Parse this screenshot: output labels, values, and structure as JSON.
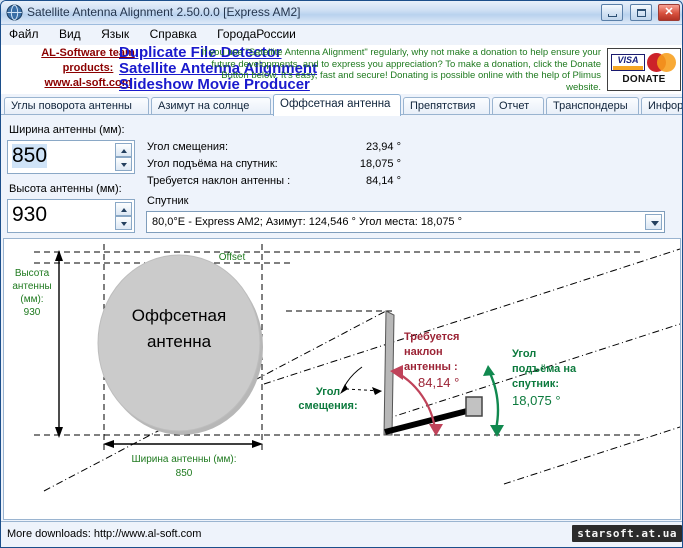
{
  "window": {
    "title": "Satellite Antenna Alignment 2.50.0.0 [Express AM2]",
    "icon": "satellite-dish-icon",
    "buttons": {
      "minimize": "minimize-icon",
      "maximize": "maximize-icon",
      "close": "✕"
    }
  },
  "menu": {
    "items": [
      {
        "label": "Файл"
      },
      {
        "label": "Вид"
      },
      {
        "label": "Язык"
      },
      {
        "label": "Справка"
      },
      {
        "label": "ГородаРоссии"
      }
    ]
  },
  "banner": {
    "products_line1": "AL-Software team",
    "products_line2": "products:",
    "products_line3": "www.al-soft.com",
    "links": [
      "Duplicate File Detector",
      "Satellite Antenna Alignment",
      "Slideshow Movie Producer"
    ],
    "promo": "If you use \"Satellite Antenna Alignment\" regularly, why not make a donation to help ensure your future developments, and to express you appreciation? To make a donation, click the Donate Button below. It's easy, fast and secure! Donating is possible online with the help of Plimus website.",
    "donate": {
      "visa": "VISA",
      "mastercard": "MasterCard",
      "label": "DONATE"
    }
  },
  "tabs": [
    {
      "label": "Углы поворота антенны",
      "active": false
    },
    {
      "label": "Азимут на солнце",
      "active": false
    },
    {
      "label": "Оффсетная антенна",
      "active": true
    },
    {
      "label": "Препятствия",
      "active": false
    },
    {
      "label": "Отчет",
      "active": false
    },
    {
      "label": "Транспондеры",
      "active": false
    },
    {
      "label": "Информация",
      "active": false
    }
  ],
  "form": {
    "width_label": "Ширина антенны (мм):",
    "width_value": "850",
    "height_label": "Высота антенны (мм):",
    "height_value": "930",
    "rows": [
      {
        "label": "Угол смещения:",
        "value": "23,94 °"
      },
      {
        "label": "Угол подъёма на спутник:",
        "value": "18,075 °"
      },
      {
        "label": "Требуется наклон антенны :",
        "value": "84,14 °"
      }
    ],
    "satellite_label": "Спутник",
    "satellite_value": "80,0°E - Express AM2;  Азимут: 124,546 °  Угол места: 18,075 °"
  },
  "diagram": {
    "antenna_title_line1": "Оффсетная",
    "antenna_title_line2": "антенна",
    "offset_label": "Offset",
    "height_line1": "Высота",
    "height_line2": "антенны",
    "height_line3": "(мм):",
    "height_value": "930",
    "width_line1": "Ширина антенны (мм):",
    "width_value": "850",
    "offset_angle_line1": "Угол",
    "offset_angle_line2": "смещения:",
    "tilt_line1": "Требуется",
    "tilt_line2": "наклон",
    "tilt_line3": "антенны :",
    "tilt_value": "84,14 °",
    "elev_line1": "Угол",
    "elev_line2": "подъёма на",
    "elev_line3": "спутник:",
    "elev_value": "18,075 °"
  },
  "status": {
    "text": "More downloads: http://www.al-soft.com",
    "watermark": "starsoft.at.ua"
  },
  "colors": {
    "green": "#1f7a1f",
    "green_bold": "#0c7a3d",
    "red": "#9b2335",
    "link": "#1a1acd",
    "product": "#8b0000"
  }
}
